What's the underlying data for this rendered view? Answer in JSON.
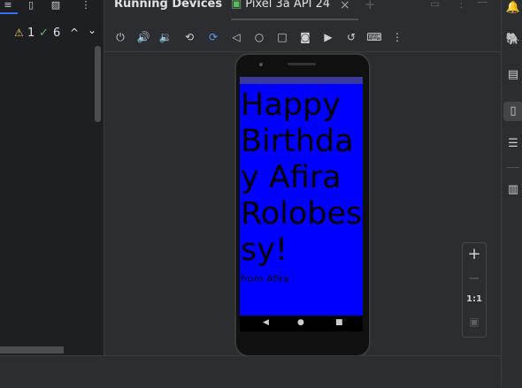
{
  "tabs": {
    "running_devices": "Running Devices",
    "device": "Pixel 3a API 24"
  },
  "inspections": {
    "warnings": "1",
    "typos": "6"
  },
  "greeting": "Happy Birthday Afira Rolobessy!",
  "signature": "from Afira",
  "zoom": {
    "plus": "+",
    "minus": "−",
    "actual": "1:1"
  },
  "icons": {
    "warning": "⚠",
    "check": "✓",
    "up": "^",
    "down": "⌄",
    "close": "×",
    "add": "+",
    "more": "⋮"
  }
}
